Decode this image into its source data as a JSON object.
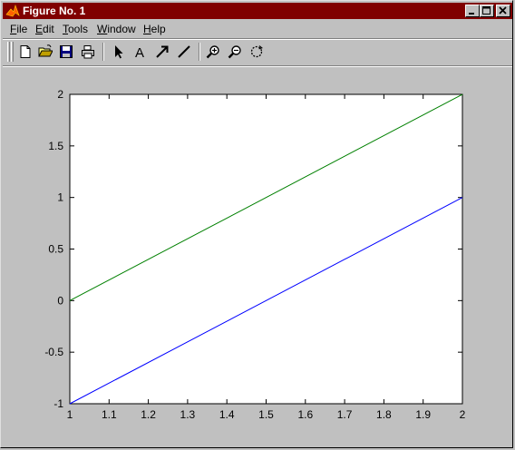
{
  "window": {
    "title": "Figure No. 1"
  },
  "menu": [
    {
      "pre": "",
      "acc": "F",
      "post": "ile"
    },
    {
      "pre": "",
      "acc": "E",
      "post": "dit"
    },
    {
      "pre": "",
      "acc": "T",
      "post": "ools"
    },
    {
      "pre": "",
      "acc": "W",
      "post": "indow"
    },
    {
      "pre": "",
      "acc": "H",
      "post": "elp"
    }
  ],
  "toolbar": {
    "icons": [
      "new-file-icon",
      "open-folder-icon",
      "save-icon",
      "print-icon",
      "select-arrow-icon",
      "insert-text-icon",
      "insert-arrow-icon",
      "insert-line-icon",
      "zoom-in-icon",
      "zoom-out-icon",
      "rotate-3d-icon"
    ]
  },
  "colors": {
    "titlebar": "#800000",
    "series_blue": "#0000ff",
    "series_green": "#008000"
  },
  "chart_data": {
    "type": "line",
    "title": "",
    "xlabel": "",
    "ylabel": "",
    "xlim": [
      1,
      2
    ],
    "ylim": [
      -1,
      2
    ],
    "grid": false,
    "xticks": [
      1,
      1.1,
      1.2,
      1.3,
      1.4,
      1.5,
      1.6,
      1.7,
      1.8,
      1.9,
      2
    ],
    "xtick_labels": [
      "1",
      "1.1",
      "1.2",
      "1.3",
      "1.4",
      "1.5",
      "1.6",
      "1.7",
      "1.8",
      "1.9",
      "2"
    ],
    "yticks": [
      -1,
      -0.5,
      0,
      0.5,
      1,
      1.5,
      2
    ],
    "ytick_labels": [
      "-1",
      "-0.5",
      "0",
      "0.5",
      "1",
      "1.5",
      "2"
    ],
    "series": [
      {
        "color": "#0000ff",
        "x": [
          1,
          2
        ],
        "y": [
          -1,
          1
        ]
      },
      {
        "color": "#008000",
        "x": [
          1,
          2
        ],
        "y": [
          0,
          2
        ]
      }
    ]
  }
}
